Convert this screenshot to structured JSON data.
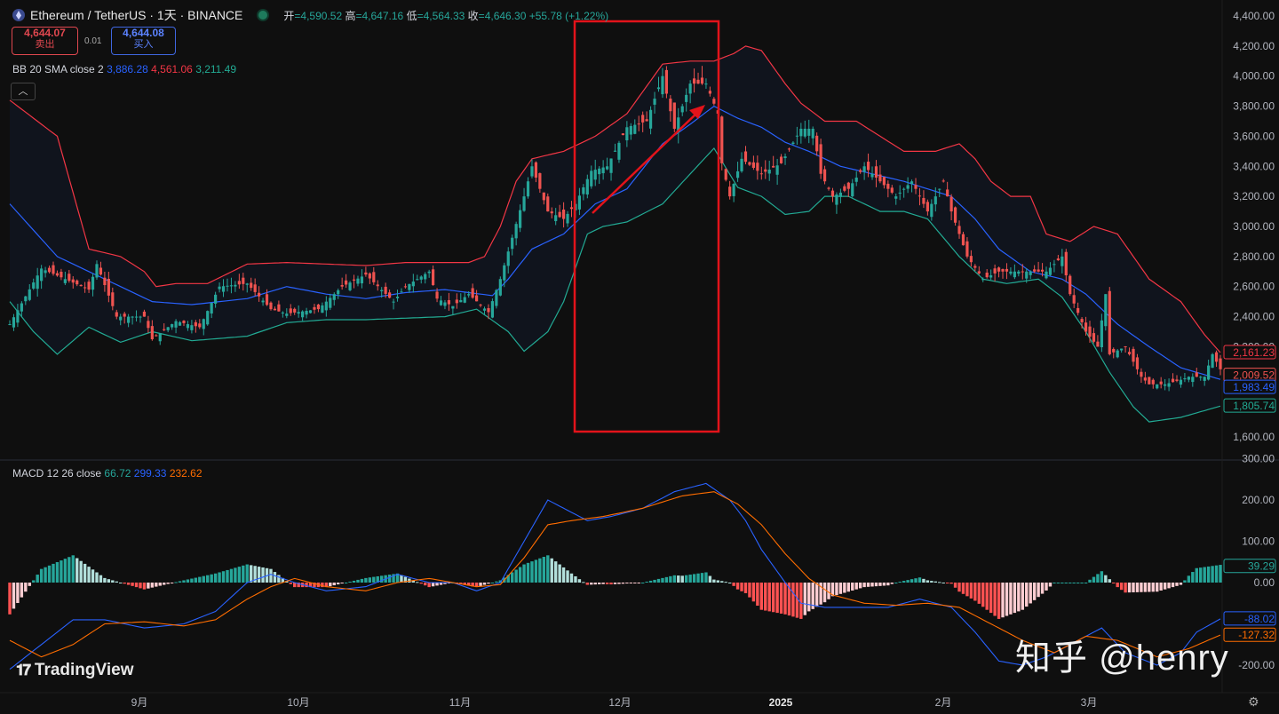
{
  "header": {
    "symbol": "Ethereum / TetherUS · 1天 · BINANCE",
    "open_label": "开",
    "open": "4,590.52",
    "high_label": "高",
    "high": "4,647.16",
    "low_label": "低",
    "low": "4,564.33",
    "close_label": "收",
    "close": "4,646.30",
    "change": "+55.78 (+1.22%)"
  },
  "trade": {
    "sell_price": "4,644.07",
    "sell_label": "卖出",
    "spread": "0.01",
    "buy_price": "4,644.08",
    "buy_label": "买入"
  },
  "bb_legend": {
    "name": "BB 20 SMA close 2",
    "basis": "3,886.28",
    "upper": "4,561.06",
    "lower": "3,211.49"
  },
  "macd_legend": {
    "name": "MACD 12 26 close",
    "hist": "66.72",
    "macd": "299.33",
    "signal": "232.62"
  },
  "branding": {
    "logo": "TradingView",
    "watermark": "知乎 @henry"
  },
  "colors": {
    "up": "#26a69a",
    "down": "#ef5350",
    "bb_upper": "#f23645",
    "bb_basis": "#2962ff",
    "bb_lower": "#22ab94",
    "macd": "#2962ff",
    "signal": "#ff6d00",
    "highlight_box": "#e3131a"
  },
  "icons": [
    "ethereum-coin-icon",
    "market-status-dot-icon",
    "collapse-chevron-icon",
    "settings-gear-icon"
  ],
  "chart_data": {
    "type": "candlestick",
    "price_axis": {
      "ticks": [
        "4,400.00",
        "4,200.00",
        "4,000.00",
        "3,800.00",
        "3,600.00",
        "3,400.00",
        "3,200.00",
        "3,000.00",
        "2,800.00",
        "2,600.00",
        "2,400.00",
        "2,200.00",
        "2,000.00",
        "1,800.00",
        "1,600.00"
      ],
      "ylim": [
        1550,
        4450
      ]
    },
    "macd_axis": {
      "ticks": [
        "300.00",
        "200.00",
        "100.00",
        "0.00",
        "-200.00"
      ],
      "ylim": [
        -250,
        300
      ]
    },
    "time_axis": [
      "9月",
      "10月",
      "11月",
      "12月",
      "2025",
      "2月",
      "3月"
    ],
    "price_labels": [
      {
        "value": "2,161.23",
        "color": "#f23645"
      },
      {
        "value": "2,009.52",
        "color": "#ef5350"
      },
      {
        "value": "1,983.49",
        "color": "#2962ff"
      },
      {
        "value": "1,805.74",
        "color": "#22ab94"
      }
    ],
    "macd_labels": [
      {
        "value": "39.29",
        "color": "#26a69a"
      },
      {
        "value": "-88.02",
        "color": "#2962ff"
      },
      {
        "value": "-127.32",
        "color": "#ff6d00"
      }
    ],
    "close_anchors": [
      [
        0,
        2350
      ],
      [
        8,
        2720
      ],
      [
        14,
        2650
      ],
      [
        20,
        2580
      ],
      [
        22,
        2750
      ],
      [
        27,
        2400
      ],
      [
        34,
        2400
      ],
      [
        36,
        2250
      ],
      [
        42,
        2370
      ],
      [
        48,
        2330
      ],
      [
        53,
        2600
      ],
      [
        60,
        2620
      ],
      [
        66,
        2450
      ],
      [
        70,
        2420
      ],
      [
        78,
        2450
      ],
      [
        84,
        2600
      ],
      [
        90,
        2680
      ],
      [
        97,
        2500
      ],
      [
        100,
        2600
      ],
      [
        106,
        2700
      ],
      [
        108,
        2520
      ],
      [
        112,
        2470
      ],
      [
        116,
        2550
      ],
      [
        121,
        2430
      ],
      [
        124,
        2650
      ],
      [
        130,
        3200
      ],
      [
        132,
        3400
      ],
      [
        136,
        3100
      ],
      [
        140,
        3050
      ],
      [
        143,
        3150
      ],
      [
        147,
        3370
      ],
      [
        151,
        3400
      ],
      [
        156,
        3660
      ],
      [
        161,
        3700
      ],
      [
        165,
        4000
      ],
      [
        168,
        3650
      ],
      [
        172,
        3950
      ],
      [
        176,
        3950
      ],
      [
        179,
        3750
      ],
      [
        180,
        3420
      ],
      [
        182,
        3200
      ],
      [
        185,
        3450
      ],
      [
        190,
        3350
      ],
      [
        195,
        3420
      ],
      [
        200,
        3650
      ],
      [
        203,
        3650
      ],
      [
        205,
        3350
      ],
      [
        208,
        3200
      ],
      [
        212,
        3250
      ],
      [
        216,
        3400
      ],
      [
        220,
        3300
      ],
      [
        224,
        3200
      ],
      [
        228,
        3300
      ],
      [
        232,
        3100
      ],
      [
        236,
        3300
      ],
      [
        238,
        3100
      ],
      [
        242,
        2800
      ],
      [
        246,
        2650
      ],
      [
        250,
        2700
      ],
      [
        256,
        2700
      ],
      [
        262,
        2700
      ],
      [
        266,
        2800
      ],
      [
        268,
        2550
      ],
      [
        272,
        2300
      ],
      [
        275,
        2200
      ],
      [
        277,
        2550
      ],
      [
        278,
        2150
      ],
      [
        282,
        2200
      ],
      [
        286,
        2000
      ],
      [
        288,
        1950
      ],
      [
        292,
        1950
      ],
      [
        296,
        1980
      ],
      [
        298,
        2000
      ],
      [
        302,
        2000
      ],
      [
        304,
        2150
      ],
      [
        306,
        2050
      ]
    ],
    "bb_upper_anchors": [
      [
        0,
        3840
      ],
      [
        12,
        3600
      ],
      [
        20,
        2850
      ],
      [
        28,
        2800
      ],
      [
        34,
        2700
      ],
      [
        37,
        2600
      ],
      [
        42,
        2620
      ],
      [
        50,
        2620
      ],
      [
        60,
        2750
      ],
      [
        70,
        2760
      ],
      [
        90,
        2740
      ],
      [
        100,
        2760
      ],
      [
        110,
        2760
      ],
      [
        116,
        2760
      ],
      [
        120,
        2800
      ],
      [
        124,
        3000
      ],
      [
        128,
        3300
      ],
      [
        132,
        3450
      ],
      [
        140,
        3500
      ],
      [
        148,
        3600
      ],
      [
        156,
        3750
      ],
      [
        165,
        4080
      ],
      [
        172,
        4100
      ],
      [
        178,
        4100
      ],
      [
        183,
        4150
      ],
      [
        186,
        4200
      ],
      [
        190,
        4170
      ],
      [
        196,
        3950
      ],
      [
        200,
        3820
      ],
      [
        206,
        3700
      ],
      [
        214,
        3700
      ],
      [
        220,
        3600
      ],
      [
        226,
        3500
      ],
      [
        234,
        3500
      ],
      [
        240,
        3550
      ],
      [
        244,
        3450
      ],
      [
        248,
        3300
      ],
      [
        253,
        3200
      ],
      [
        258,
        3200
      ],
      [
        262,
        2950
      ],
      [
        268,
        2900
      ],
      [
        274,
        3000
      ],
      [
        280,
        2950
      ],
      [
        288,
        2650
      ],
      [
        296,
        2500
      ],
      [
        302,
        2280
      ],
      [
        306,
        2161
      ]
    ],
    "bb_basis_anchors": [
      [
        0,
        3150
      ],
      [
        12,
        2800
      ],
      [
        20,
        2700
      ],
      [
        28,
        2600
      ],
      [
        36,
        2500
      ],
      [
        46,
        2480
      ],
      [
        60,
        2520
      ],
      [
        70,
        2600
      ],
      [
        80,
        2550
      ],
      [
        90,
        2520
      ],
      [
        100,
        2560
      ],
      [
        110,
        2580
      ],
      [
        116,
        2560
      ],
      [
        122,
        2540
      ],
      [
        126,
        2650
      ],
      [
        132,
        2850
      ],
      [
        140,
        2950
      ],
      [
        148,
        3150
      ],
      [
        156,
        3250
      ],
      [
        165,
        3550
      ],
      [
        172,
        3680
      ],
      [
        178,
        3800
      ],
      [
        184,
        3720
      ],
      [
        190,
        3660
      ],
      [
        196,
        3560
      ],
      [
        202,
        3500
      ],
      [
        210,
        3400
      ],
      [
        218,
        3350
      ],
      [
        226,
        3300
      ],
      [
        232,
        3250
      ],
      [
        238,
        3200
      ],
      [
        244,
        3050
      ],
      [
        250,
        2850
      ],
      [
        258,
        2700
      ],
      [
        266,
        2650
      ],
      [
        272,
        2550
      ],
      [
        280,
        2350
      ],
      [
        288,
        2200
      ],
      [
        296,
        2060
      ],
      [
        306,
        1983
      ]
    ],
    "bb_lower_anchors": [
      [
        0,
        2500
      ],
      [
        6,
        2300
      ],
      [
        12,
        2150
      ],
      [
        20,
        2330
      ],
      [
        28,
        2230
      ],
      [
        36,
        2300
      ],
      [
        46,
        2240
      ],
      [
        60,
        2270
      ],
      [
        70,
        2360
      ],
      [
        80,
        2380
      ],
      [
        90,
        2380
      ],
      [
        100,
        2390
      ],
      [
        110,
        2400
      ],
      [
        118,
        2450
      ],
      [
        126,
        2300
      ],
      [
        130,
        2170
      ],
      [
        136,
        2300
      ],
      [
        140,
        2500
      ],
      [
        146,
        2950
      ],
      [
        150,
        3000
      ],
      [
        156,
        3030
      ],
      [
        165,
        3150
      ],
      [
        172,
        3350
      ],
      [
        178,
        3520
      ],
      [
        184,
        3260
      ],
      [
        190,
        3200
      ],
      [
        196,
        3080
      ],
      [
        202,
        3100
      ],
      [
        206,
        3200
      ],
      [
        212,
        3200
      ],
      [
        220,
        3100
      ],
      [
        226,
        3100
      ],
      [
        232,
        3050
      ],
      [
        240,
        2800
      ],
      [
        246,
        2650
      ],
      [
        252,
        2620
      ],
      [
        260,
        2650
      ],
      [
        266,
        2530
      ],
      [
        272,
        2300
      ],
      [
        278,
        2030
      ],
      [
        284,
        1800
      ],
      [
        288,
        1700
      ],
      [
        296,
        1730
      ],
      [
        306,
        1805
      ]
    ],
    "macd_anchors": [
      [
        0,
        -210
      ],
      [
        8,
        -150
      ],
      [
        16,
        -90
      ],
      [
        24,
        -90
      ],
      [
        34,
        -110
      ],
      [
        44,
        -100
      ],
      [
        52,
        -70
      ],
      [
        60,
        0
      ],
      [
        66,
        20
      ],
      [
        72,
        0
      ],
      [
        80,
        -20
      ],
      [
        90,
        -10
      ],
      [
        98,
        20
      ],
      [
        106,
        0
      ],
      [
        112,
        0
      ],
      [
        118,
        -20
      ],
      [
        124,
        0
      ],
      [
        130,
        100
      ],
      [
        136,
        200
      ],
      [
        140,
        180
      ],
      [
        146,
        150
      ],
      [
        152,
        160
      ],
      [
        160,
        180
      ],
      [
        168,
        220
      ],
      [
        176,
        240
      ],
      [
        182,
        200
      ],
      [
        186,
        150
      ],
      [
        190,
        80
      ],
      [
        196,
        0
      ],
      [
        200,
        -50
      ],
      [
        206,
        -60
      ],
      [
        214,
        -60
      ],
      [
        222,
        -60
      ],
      [
        230,
        -40
      ],
      [
        238,
        -60
      ],
      [
        244,
        -120
      ],
      [
        250,
        -190
      ],
      [
        256,
        -200
      ],
      [
        262,
        -180
      ],
      [
        270,
        -140
      ],
      [
        276,
        -110
      ],
      [
        282,
        -170
      ],
      [
        290,
        -200
      ],
      [
        296,
        -170
      ],
      [
        300,
        -120
      ],
      [
        306,
        -88
      ]
    ],
    "signal_anchors": [
      [
        0,
        -140
      ],
      [
        8,
        -180
      ],
      [
        16,
        -150
      ],
      [
        24,
        -100
      ],
      [
        34,
        -95
      ],
      [
        44,
        -105
      ],
      [
        52,
        -90
      ],
      [
        60,
        -40
      ],
      [
        66,
        -10
      ],
      [
        72,
        10
      ],
      [
        80,
        -10
      ],
      [
        90,
        -20
      ],
      [
        98,
        0
      ],
      [
        106,
        10
      ],
      [
        112,
        0
      ],
      [
        118,
        -10
      ],
      [
        124,
        -5
      ],
      [
        130,
        60
      ],
      [
        136,
        140
      ],
      [
        142,
        150
      ],
      [
        150,
        160
      ],
      [
        160,
        180
      ],
      [
        170,
        210
      ],
      [
        178,
        220
      ],
      [
        184,
        190
      ],
      [
        190,
        140
      ],
      [
        196,
        70
      ],
      [
        202,
        10
      ],
      [
        208,
        -30
      ],
      [
        216,
        -50
      ],
      [
        224,
        -55
      ],
      [
        232,
        -50
      ],
      [
        240,
        -60
      ],
      [
        248,
        -100
      ],
      [
        256,
        -140
      ],
      [
        264,
        -170
      ],
      [
        272,
        -130
      ],
      [
        280,
        -140
      ],
      [
        290,
        -180
      ],
      [
        298,
        -160
      ],
      [
        306,
        -127
      ]
    ],
    "annotations": [
      {
        "type": "rectangle",
        "color": "#e3131a"
      },
      {
        "type": "arrow",
        "direction": "up-right",
        "color": "#e3131a"
      }
    ]
  }
}
